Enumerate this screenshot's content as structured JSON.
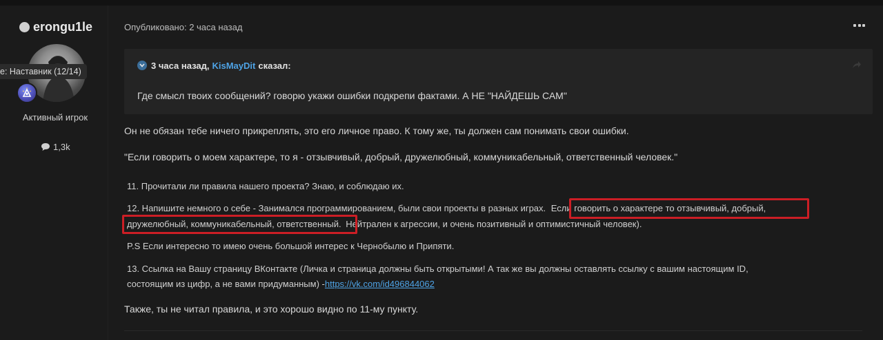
{
  "author": {
    "name": "erongu1le",
    "tooltip": "e: Наставник (12/14)",
    "rank": "Активный игрок",
    "reputation": "1,3k"
  },
  "post": {
    "meta": "Опубликовано: 2 часа назад",
    "quote": {
      "time": "3 часа назад,",
      "author": "KisMayDit",
      "said": "сказал:",
      "text": "Где смысл твоих сообщений? говорю укажи ошибки подкрепи фактами. А НЕ \"НАЙДЕШЬ САМ\""
    },
    "paragraph1": "Он не обязан тебе ничего прикреплять, это его личное право. К тому же, ты должен сам понимать свои ошибки.",
    "paragraph2": "\"Если говорить о моем характере, то я - отзывчивый, добрый, дружелюбный, коммуникабельный, ответственный человек.\"",
    "quoted_form": {
      "item11": "11. Прочитали ли правила нашего проекта? Знаю, и соблюдаю их.",
      "item12_line1_start": "12. Напишите немного о себе - Занимался программированием, были свои проекты в разных играх.",
      "item12_line1_highlight": "Если говорить о характере то отзывчивый, добрый,",
      "item12_line2_highlight": "дружелюбный, коммуникабельный, ответственный.",
      "item12_line2_rest": "Нейтрален к агрессии, и очень позитивный и оптимистичный человек).",
      "ps": "P.S Если интересно то имею очень большой интерес к Чернобылю и Припяти.",
      "item13_line1": "13. Ссылка на Вашу страницу ВКонтакте (Личка и страница должны быть открытыми! А так же вы должны оставлять ссылку с вашим настоящим ID,",
      "item13_line2": "состоящим из цифр, а не вами придуманным) -",
      "item13_link": "https://vk.com/id496844062"
    },
    "closing": "Также, ты не читал правила, и это хорошо видно по 11-му пункту."
  },
  "colors": {
    "background": "#1b1b1b",
    "quote_background": "#242424",
    "link": "#4ea3e6",
    "highlight_border": "#cc1e25"
  },
  "icons": [
    "online-dot-icon",
    "badge-icon",
    "comment-icon",
    "more-icon",
    "quote-chevron-icon",
    "share-icon"
  ]
}
